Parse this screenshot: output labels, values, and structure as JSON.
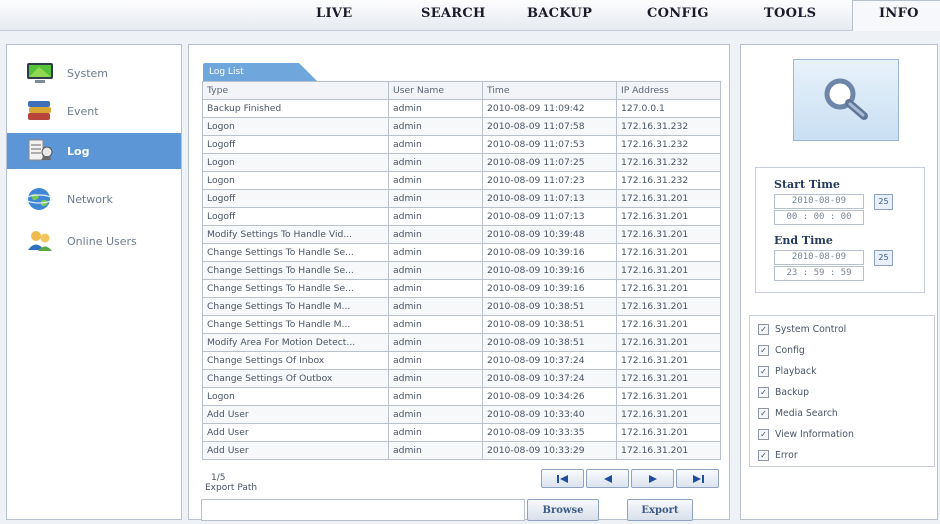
{
  "nav": {
    "tabs": [
      {
        "label": "LIVE"
      },
      {
        "label": "SEARCH"
      },
      {
        "label": "BACKUP"
      },
      {
        "label": "CONFIG"
      },
      {
        "label": "TOOLS"
      },
      {
        "label": "INFO"
      }
    ],
    "active": "INFO"
  },
  "sidebar": {
    "items": [
      {
        "label": "System",
        "icon": "monitor-icon"
      },
      {
        "label": "Event",
        "icon": "books-icon"
      },
      {
        "label": "Log",
        "icon": "log-icon",
        "active": true
      },
      {
        "label": "Network",
        "icon": "globe-icon"
      },
      {
        "label": "Online Users",
        "icon": "users-icon"
      }
    ]
  },
  "log": {
    "tab_label": "Log List",
    "columns": [
      "Type",
      "User Name",
      "Time",
      "IP Address"
    ],
    "rows": [
      [
        "Backup Finished",
        "admin",
        "2010-08-09 11:09:42",
        "127.0.0.1"
      ],
      [
        "Logon",
        "admin",
        "2010-08-09 11:07:58",
        "172.16.31.232"
      ],
      [
        "Logoff",
        "admin",
        "2010-08-09 11:07:53",
        "172.16.31.232"
      ],
      [
        "Logon",
        "admin",
        "2010-08-09 11:07:25",
        "172.16.31.232"
      ],
      [
        "Logon",
        "admin",
        "2010-08-09 11:07:23",
        "172.16.31.232"
      ],
      [
        "Logoff",
        "admin",
        "2010-08-09 11:07:13",
        "172.16.31.201"
      ],
      [
        "Logoff",
        "admin",
        "2010-08-09 11:07:13",
        "172.16.31.201"
      ],
      [
        "Modify Settings To Handle Vid...",
        "admin",
        "2010-08-09 10:39:48",
        "172.16.31.201"
      ],
      [
        "Change Settings To Handle Se...",
        "admin",
        "2010-08-09 10:39:16",
        "172.16.31.201"
      ],
      [
        "Change Settings To Handle Se...",
        "admin",
        "2010-08-09 10:39:16",
        "172.16.31.201"
      ],
      [
        "Change Settings To Handle Se...",
        "admin",
        "2010-08-09 10:39:16",
        "172.16.31.201"
      ],
      [
        "Change Settings To Handle M...",
        "admin",
        "2010-08-09 10:38:51",
        "172.16.31.201"
      ],
      [
        "Change Settings To Handle M...",
        "admin",
        "2010-08-09 10:38:51",
        "172.16.31.201"
      ],
      [
        "Modify Area For Motion Detect...",
        "admin",
        "2010-08-09 10:38:51",
        "172.16.31.201"
      ],
      [
        "Change Settings Of Inbox",
        "admin",
        "2010-08-09 10:37:24",
        "172.16.31.201"
      ],
      [
        "Change Settings Of Outbox",
        "admin",
        "2010-08-09 10:37:24",
        "172.16.31.201"
      ],
      [
        "Logon",
        "admin",
        "2010-08-09 10:34:26",
        "172.16.31.201"
      ],
      [
        "Add User",
        "admin",
        "2010-08-09 10:33:40",
        "172.16.31.201"
      ],
      [
        "Add User",
        "admin",
        "2010-08-09 10:33:35",
        "172.16.31.201"
      ],
      [
        "Add User",
        "admin",
        "2010-08-09 10:33:29",
        "172.16.31.201"
      ]
    ],
    "page": "1/5",
    "export_path_label": "Export Path",
    "export_path_value": "",
    "browse_label": "Browse",
    "export_label": "Export"
  },
  "search": {
    "start_label": "Start Time",
    "start_date": "2010-08-09",
    "start_time": "00 : 00 : 00",
    "end_label": "End Time",
    "end_date": "2010-08-09",
    "end_time": "23 : 59 : 59",
    "calendar_glyph": "25",
    "filters": [
      {
        "label": "System Control",
        "checked": true
      },
      {
        "label": "Config",
        "checked": true
      },
      {
        "label": "Playback",
        "checked": true
      },
      {
        "label": "Backup",
        "checked": true
      },
      {
        "label": "Media Search",
        "checked": true
      },
      {
        "label": "View Information",
        "checked": true
      },
      {
        "label": "Error",
        "checked": true
      }
    ]
  },
  "colors": {
    "accent": "#5c96d6",
    "tab_blue": "#6fa6dc",
    "panel_border": "#b7c1cf"
  }
}
